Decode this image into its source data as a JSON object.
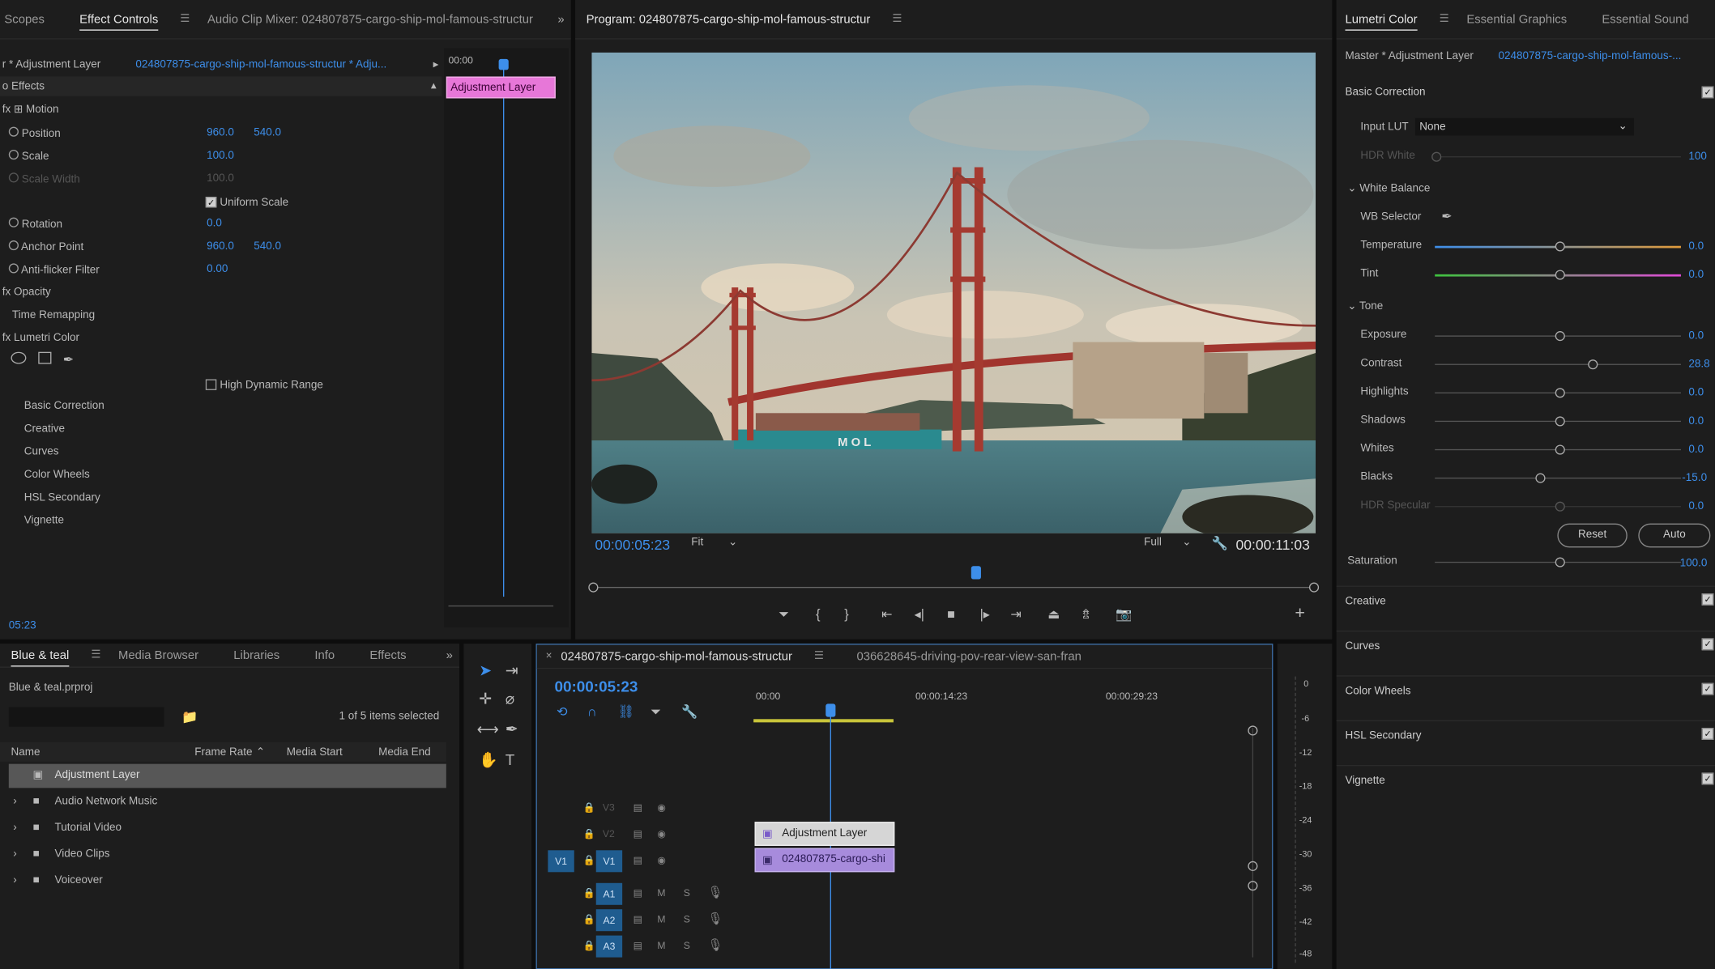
{
  "effect_panel": {
    "tabs": [
      "Scopes",
      "Effect Controls",
      "Audio Clip Mixer: 024807875-cargo-ship-mol-famous-structur"
    ],
    "source_label": "r * Adjustment Layer",
    "clip_label": "024807875-cargo-ship-mol-famous-structur * Adju...",
    "section_title": "o Effects",
    "mini_timecode": "00:00",
    "mini_clip": "Adjustment Layer",
    "motion": "Motion",
    "position_label": "Position",
    "position_x": "960.0",
    "position_y": "540.0",
    "scale_label": "Scale",
    "scale_val": "100.0",
    "scale_width_label": "Scale Width",
    "scale_width_val": "100.0",
    "uniform_scale": "Uniform Scale",
    "rotation_label": "Rotation",
    "rotation_val": "0.0",
    "anchor_label": "Anchor Point",
    "anchor_x": "960.0",
    "anchor_y": "540.0",
    "antiflicker_label": "Anti-flicker Filter",
    "antiflicker_val": "0.00",
    "opacity": "Opacity",
    "time_remap": "Time Remapping",
    "lumetri": "Lumetri Color",
    "hdr": "High Dynamic Range",
    "sub_items": [
      "Basic Correction",
      "Creative",
      "Curves",
      "Color Wheels",
      "HSL Secondary",
      "Vignette"
    ],
    "timecode": "05:23"
  },
  "program": {
    "title": "Program: 024807875-cargo-ship-mol-famous-structur",
    "timecode": "00:00:05:23",
    "fit": "Fit",
    "quality": "Full",
    "duration": "00:00:11:03",
    "playhead": 0.53
  },
  "lumetri": {
    "tabs": [
      "Lumetri Color",
      "Essential Graphics",
      "Essential Sound"
    ],
    "master": "Master * Adjustment Layer",
    "clip": "024807875-cargo-ship-mol-famous-...",
    "basic": "Basic Correction",
    "input_lut_label": "Input LUT",
    "input_lut_value": "None",
    "hdr_white_label": "HDR White",
    "hdr_white_val": "100",
    "white_balance": "White Balance",
    "wb_selector": "WB Selector",
    "temperature_label": "Temperature",
    "temperature_val": "0.0",
    "tint_label": "Tint",
    "tint_val": "0.0",
    "tone": "Tone",
    "exposure_label": "Exposure",
    "exposure_val": "0.0",
    "contrast_label": "Contrast",
    "contrast_val": "28.8",
    "highlights_label": "Highlights",
    "highlights_val": "0.0",
    "shadows_label": "Shadows",
    "shadows_val": "0.0",
    "whites_label": "Whites",
    "whites_val": "0.0",
    "blacks_label": "Blacks",
    "blacks_val": "-15.0",
    "hdr_spec_label": "HDR Specular",
    "hdr_spec_val": "0.0",
    "reset": "Reset",
    "auto": "Auto",
    "saturation_label": "Saturation",
    "saturation_val": "100.0",
    "sections": [
      "Creative",
      "Curves",
      "Color Wheels",
      "HSL Secondary",
      "Vignette"
    ]
  },
  "project": {
    "tabs": [
      "Blue & teal",
      "Media Browser",
      "Libraries",
      "Info",
      "Effects"
    ],
    "file": "Blue & teal.prproj",
    "selected": "1 of 5 items selected",
    "columns": [
      "Name",
      "Frame Rate",
      "Media Start",
      "Media End"
    ],
    "items": [
      "Adjustment Layer",
      "Audio Network Music",
      "Tutorial Video",
      "Video Clips",
      "Voiceover"
    ]
  },
  "timeline": {
    "tabs": [
      "024807875-cargo-ship-mol-famous-structur",
      "036628645-driving-pov-rear-view-san-fran"
    ],
    "timecode": "00:00:05:23",
    "ruler": [
      "00:00",
      "00:00:14:23",
      "00:00:29:23"
    ],
    "tracks": [
      "V3",
      "V2",
      "V1",
      "A1",
      "A2",
      "A3"
    ],
    "src_v": "V1",
    "src_a": "A1",
    "clip_adjust": "Adjustment Layer",
    "clip_video": "024807875-cargo-shi",
    "meter": [
      "0",
      "-6",
      "-12",
      "-18",
      "-24",
      "-30",
      "-36",
      "-42",
      "-48"
    ]
  },
  "colors": {
    "accent": "#3d8eea",
    "pink": "#e777d8",
    "clip_purple": "#a78bdc"
  }
}
